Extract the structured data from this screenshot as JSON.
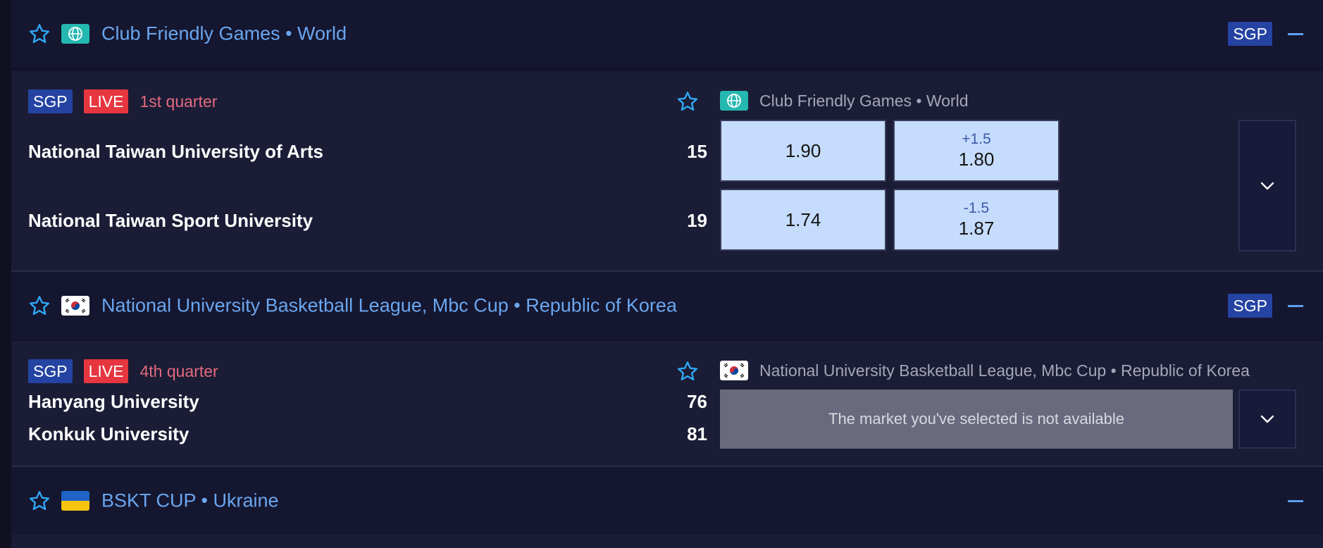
{
  "leagues": [
    {
      "title": "Club Friendly Games • World",
      "flag_icon": "globe-icon",
      "sgp_label": "SGP",
      "match": {
        "sgp_label": "SGP",
        "live_label": "LIVE",
        "period": "1st quarter",
        "league_title": "Club Friendly Games • World",
        "home_team": "National Taiwan University of Arts",
        "away_team": "National Taiwan Sport University",
        "home_score": "15",
        "away_score": "19",
        "home_moneyline": "1.90",
        "away_moneyline": "1.74",
        "home_spread_line": "+1.5",
        "home_spread_price": "1.80",
        "away_spread_line": "-1.5",
        "away_spread_price": "1.87"
      }
    },
    {
      "title": "National University Basketball League, Mbc Cup • Republic of Korea",
      "flag_icon": "south-korea-flag-icon",
      "sgp_label": "SGP",
      "match": {
        "sgp_label": "SGP",
        "live_label": "LIVE",
        "period": "4th quarter",
        "league_title": "National University Basketball League, Mbc Cup • Republic of Korea",
        "home_team": "Hanyang University",
        "away_team": "Konkuk University",
        "home_score": "76",
        "away_score": "81",
        "unavailable_text": "The market you've selected is not available"
      }
    },
    {
      "title": "BSKT CUP • Ukraine",
      "flag_icon": "ukraine-flag-icon"
    }
  ],
  "colors": {
    "league_title": "#6aa6ef",
    "sgp_badge": "#2443a3",
    "live_badge": "#e6363f",
    "quarter_text": "#e36a7f",
    "odds_cell": "#c6dcfd",
    "unavailable_bg": "#6a6a7e"
  },
  "icons": {
    "favorite": "star-outline-icon",
    "collapse": "minus-icon",
    "expand": "chevron-down-icon"
  }
}
